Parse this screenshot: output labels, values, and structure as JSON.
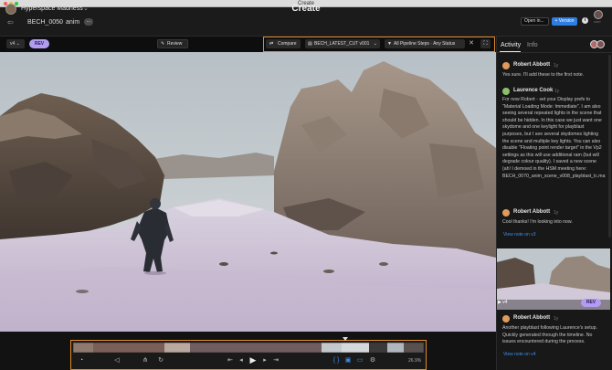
{
  "window": {
    "title": "Create"
  },
  "app": {
    "title": "Create",
    "project_name": "Hyperspace Madness",
    "breadcrumb": [
      "BECH_0050",
      "anim"
    ],
    "breadcrumb_more": "...",
    "open_in_label": "Open in...",
    "version_label": "+ Version",
    "info_icon": "i",
    "user_label": "user"
  },
  "viewer_toolbar": {
    "view_select": "v4",
    "rev_badge": "REV",
    "review_label": "Review",
    "compare_label": "Compare",
    "cut_select": "BECH_LATEST_CUT v001",
    "filter_label": "All Pipeline Steps  ·  Any Status",
    "close_symbol": "✕",
    "expand_symbol": "⛶"
  },
  "timeline": {
    "zoom_level": "26.9%"
  },
  "panel": {
    "tabs": [
      "Activity",
      "Info"
    ],
    "comments": [
      {
        "author": "Robert Abbott",
        "time": "1y",
        "text": "Yes sure. I'll add these to the first note."
      },
      {
        "author": "Laurence Cook",
        "time": "1y",
        "text": "For now Robert - set your Display prefs to \"Material Loading Mode: Immediate\". I am also seeing several repeated lights in the scene that should be hidden. In this case we just want one skydome and one keylight for playblast purposes, but I see several skydomes lighting the scene and multiple key lights. You can also disable \"Floating point render target\" in the Vp2 settings as this will use additional ram (but will degrade colour quality). I saved a new scene (ah! I demoed in the HSM meeting here: BECH_0070_anim_scene_v008_playblast_lc.ma"
      },
      {
        "author": "Robert Abbott",
        "time": "1y",
        "text": "Cool thanks! I'm looking into now."
      },
      {
        "author": "Robert Abbott",
        "time": "1y",
        "text": "Another playblast following Laurence's setup. Quickly generated through the timeline. No issues encountered during the process."
      }
    ],
    "view_links": [
      "View note on v3",
      "View note on v4"
    ],
    "thumb_version": "v4",
    "thumb_rev": "REV"
  },
  "colors": {
    "accent_orange": "#e08a2c",
    "rev_purple": "#b29cf2",
    "link_blue": "#3b8ff0"
  }
}
